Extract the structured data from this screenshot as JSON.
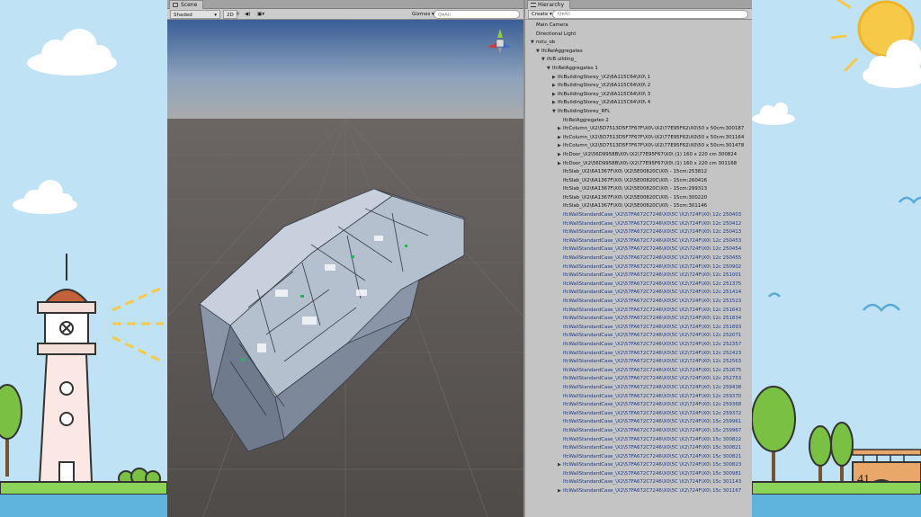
{
  "scene": {
    "tab_label": "Scene",
    "shading_mode": "Shaded",
    "mode_2d": "2D",
    "gizmos_label": "Gizmos",
    "search_placeholder": "Q▾All"
  },
  "hierarchy": {
    "tab_label": "Hierarchy",
    "create_label": "Create ▾",
    "search_placeholder": "Q▾All",
    "items": [
      {
        "indent": 0,
        "arrow": "",
        "label": "Main Camera"
      },
      {
        "indent": 0,
        "arrow": "",
        "label": "Directional Light"
      },
      {
        "indent": 0,
        "arrow": "▼",
        "label": "nstu_ob"
      },
      {
        "indent": 1,
        "arrow": "▼",
        "label": "IfcRelAggregates"
      },
      {
        "indent": 2,
        "arrow": "▼",
        "label": "ifcB uilding_"
      },
      {
        "indent": 3,
        "arrow": "▼",
        "label": "IfcRelAggregates 1"
      },
      {
        "indent": 4,
        "arrow": "▶",
        "label": "IfcBuildingStorey_\\X2\\6A115C64\\X0\\ 1"
      },
      {
        "indent": 4,
        "arrow": "▶",
        "label": "IfcBuildingStorey_\\X2\\6A115C64\\X0\\ 2"
      },
      {
        "indent": 4,
        "arrow": "▶",
        "label": "IfcBuildingStorey_\\X2\\6A115C64\\X0\\ 3"
      },
      {
        "indent": 4,
        "arrow": "▶",
        "label": "IfcBuildingStorey_\\X2\\6A115C64\\X0\\ 4"
      },
      {
        "indent": 4,
        "arrow": "▼",
        "label": "IfcBuildingStorey_RFL"
      },
      {
        "indent": 5,
        "arrow": "",
        "label": "IfcRelAggregates 2"
      },
      {
        "indent": 5,
        "arrow": "▶",
        "label": "IfcColumn_\\X2\\5D7513D5F7F67F\\X0\\-\\X2\\77E95F62\\X0\\50 x 50cm:300187"
      },
      {
        "indent": 5,
        "arrow": "▶",
        "label": "IfcColumn_\\X2\\5D7513D5F7F67F\\X0\\-\\X2\\77E95F62\\X0\\50 x 50cm:301164"
      },
      {
        "indent": 5,
        "arrow": "▶",
        "label": "IfcColumn_\\X2\\5D7513D5F7F67F\\X0\\-\\X2\\77E95F62\\X0\\50 x 50cm:301478"
      },
      {
        "indent": 5,
        "arrow": "▶",
        "label": "IfcDoor_\\X2\\56D9958B\\X0\\-\\X2\\77E95F67\\X0\\ (1) 160 x 220 cm 300824"
      },
      {
        "indent": 5,
        "arrow": "▶",
        "label": "IfcDoor_\\X2\\56D9958B\\X0\\-\\X2\\77E95F67\\X0\\ (1) 160 x 220 cm 301168"
      },
      {
        "indent": 5,
        "arrow": "",
        "label": "IfcSlab_\\X2\\6A1367F\\X0\\ \\X2\\5E00820C\\X0\\ - 15cm:253812"
      },
      {
        "indent": 5,
        "arrow": "",
        "label": "IfcSlab_\\X2\\6A1367F\\X0\\ \\X2\\5E00820C\\X0\\ - 15cm:260416"
      },
      {
        "indent": 5,
        "arrow": "",
        "label": "IfcSlab_\\X2\\6A1367F\\X0\\ \\X2\\5E00820C\\X0\\ - 15cm:299313"
      },
      {
        "indent": 5,
        "arrow": "",
        "label": "IfcSlab_\\X2\\6A1367F\\X0\\ \\X2\\5E00820C\\X0\\ - 15cm:300220"
      },
      {
        "indent": 5,
        "arrow": "",
        "label": "IfcSlab_\\X2\\6A1367F\\X0\\ \\X2\\5E00820C\\X0\\ - 15cm:301146"
      },
      {
        "indent": 5,
        "arrow": "",
        "label": "IfcWallStandardCase_\\X2\\57FA672C7246\\X0\\5C \\X2\\724F\\X0\\ 12c 250403",
        "blue": true
      },
      {
        "indent": 5,
        "arrow": "",
        "label": "IfcWallStandardCase_\\X2\\57FA672C7246\\X0\\5C \\X2\\724F\\X0\\ 12c 250412",
        "blue": true
      },
      {
        "indent": 5,
        "arrow": "",
        "label": "IfcWallStandardCase_\\X2\\57FA672C7246\\X0\\5C \\X2\\724F\\X0\\ 12c 250413",
        "blue": true
      },
      {
        "indent": 5,
        "arrow": "",
        "label": "IfcWallStandardCase_\\X2\\57FA672C7246\\X0\\5C \\X2\\724F\\X0\\ 12c 250453",
        "blue": true
      },
      {
        "indent": 5,
        "arrow": "",
        "label": "IfcWallStandardCase_\\X2\\57FA672C7246\\X0\\5C \\X2\\724F\\X0\\ 12c 250454",
        "blue": true
      },
      {
        "indent": 5,
        "arrow": "",
        "label": "IfcWallStandardCase_\\X2\\57FA672C7246\\X0\\5C \\X2\\724F\\X0\\ 12c 250455",
        "blue": true
      },
      {
        "indent": 5,
        "arrow": "",
        "label": "IfcWallStandardCase_\\X2\\57FA672C7246\\X0\\5C \\X2\\724F\\X0\\ 12c 250902",
        "blue": true
      },
      {
        "indent": 5,
        "arrow": "",
        "label": "IfcWallStandardCase_\\X2\\57FA672C7246\\X0\\5C \\X2\\724F\\X0\\ 12c 251001",
        "blue": true
      },
      {
        "indent": 5,
        "arrow": "",
        "label": "IfcWallStandardCase_\\X2\\57FA672C7246\\X0\\5C \\X2\\724F\\X0\\ 12c 251375",
        "blue": true
      },
      {
        "indent": 5,
        "arrow": "",
        "label": "IfcWallStandardCase_\\X2\\57FA672C7246\\X0\\5C \\X2\\724F\\X0\\ 12c 251414",
        "blue": true
      },
      {
        "indent": 5,
        "arrow": "",
        "label": "IfcWallStandardCase_\\X2\\57FA672C7246\\X0\\5C \\X2\\724F\\X0\\ 12c 251523",
        "blue": true
      },
      {
        "indent": 5,
        "arrow": "",
        "label": "IfcWallStandardCase_\\X2\\57FA672C7246\\X0\\5C \\X2\\724F\\X0\\ 12c 251643",
        "blue": true
      },
      {
        "indent": 5,
        "arrow": "",
        "label": "IfcWallStandardCase_\\X2\\57FA672C7246\\X0\\5C \\X2\\724F\\X0\\ 12c 251834",
        "blue": true
      },
      {
        "indent": 5,
        "arrow": "",
        "label": "IfcWallStandardCase_\\X2\\57FA672C7246\\X0\\5C \\X2\\724F\\X0\\ 12c 251893",
        "blue": true
      },
      {
        "indent": 5,
        "arrow": "",
        "label": "IfcWallStandardCase_\\X2\\57FA672C7246\\X0\\5C \\X2\\724F\\X0\\ 12c 252071",
        "blue": true
      },
      {
        "indent": 5,
        "arrow": "",
        "label": "IfcWallStandardCase_\\X2\\57FA672C7246\\X0\\5C \\X2\\724F\\X0\\ 12c 252357",
        "blue": true
      },
      {
        "indent": 5,
        "arrow": "",
        "label": "IfcWallStandardCase_\\X2\\57FA672C7246\\X0\\5C \\X2\\724F\\X0\\ 12c 252423",
        "blue": true
      },
      {
        "indent": 5,
        "arrow": "",
        "label": "IfcWallStandardCase_\\X2\\57FA672C7246\\X0\\5C \\X2\\724F\\X0\\ 12c 252563",
        "blue": true
      },
      {
        "indent": 5,
        "arrow": "",
        "label": "IfcWallStandardCase_\\X2\\57FA672C7246\\X0\\5C \\X2\\724F\\X0\\ 12c 252675",
        "blue": true
      },
      {
        "indent": 5,
        "arrow": "",
        "label": "IfcWallStandardCase_\\X2\\57FA672C7246\\X0\\5C \\X2\\724F\\X0\\ 12c 252753",
        "blue": true
      },
      {
        "indent": 5,
        "arrow": "",
        "label": "IfcWallStandardCase_\\X2\\57FA672C7246\\X0\\5C \\X2\\724F\\X0\\ 12c 259438",
        "blue": true
      },
      {
        "indent": 5,
        "arrow": "",
        "label": "IfcWallStandardCase_\\X2\\57FA672C7246\\X0\\5C \\X2\\724F\\X0\\ 12c 259370",
        "blue": true
      },
      {
        "indent": 5,
        "arrow": "",
        "label": "IfcWallStandardCase_\\X2\\57FA672C7246\\X0\\5C \\X2\\724F\\X0\\ 12c 259368",
        "blue": true
      },
      {
        "indent": 5,
        "arrow": "",
        "label": "IfcWallStandardCase_\\X2\\57FA672C7246\\X0\\5C \\X2\\724F\\X0\\ 12c 259372",
        "blue": true
      },
      {
        "indent": 5,
        "arrow": "",
        "label": "IfcWallStandardCase_\\X2\\57FA672C7246\\X0\\5C \\X2\\724F\\X0\\ 15c 259961",
        "blue": true
      },
      {
        "indent": 5,
        "arrow": "",
        "label": "IfcWallStandardCase_\\X2\\57FA672C7246\\X0\\5C \\X2\\724F\\X0\\ 15c 259967",
        "blue": true
      },
      {
        "indent": 5,
        "arrow": "",
        "label": "IfcWallStandardCase_\\X2\\57FA672C7246\\X0\\5C \\X2\\724F\\X0\\ 15c 300822",
        "blue": true
      },
      {
        "indent": 5,
        "arrow": "",
        "label": "IfcWallStandardCase_\\X2\\57FA672C7246\\X0\\5C \\X2\\724F\\X0\\ 15c 300821",
        "blue": true
      },
      {
        "indent": 5,
        "arrow": "",
        "label": "IfcWallStandardCase_\\X2\\57FA672C7246\\X0\\5C \\X2\\724F\\X0\\ 15c 300821",
        "blue": true
      },
      {
        "indent": 5,
        "arrow": "▶",
        "label": "IfcWallStandardCase_\\X2\\57FA672C7246\\X0\\5C \\X2\\724F\\X0\\ 15c 300823",
        "blue": true
      },
      {
        "indent": 5,
        "arrow": "",
        "label": "IfcWallStandardCase_\\X2\\57FA672C7246\\X0\\5C \\X2\\724F\\X0\\ 15c 300981",
        "blue": true
      },
      {
        "indent": 5,
        "arrow": "",
        "label": "IfcWallStandardCase_\\X2\\57FA672C7246\\X0\\5C \\X2\\724F\\X0\\ 15c 301143",
        "blue": true
      },
      {
        "indent": 5,
        "arrow": "▶",
        "label": "IfcWallStandardCase_\\X2\\57FA672C7246\\X0\\5C \\X2\\724F\\X0\\ 15c 301167",
        "blue": true
      }
    ]
  },
  "slide": {
    "page_number": "41"
  },
  "colors": {
    "sky": "#bfe3f4",
    "grass": "#8cd35a",
    "water": "#5fb4dd",
    "sun": "#f7c948",
    "editor_panel": "#c4c4c4",
    "viewport_ground": "#5a5755"
  },
  "icons": [
    "scene-icon",
    "hierarchy-icon",
    "audio-icon",
    "lighting-icon",
    "gizmo-axis-icon",
    "search-icon"
  ]
}
